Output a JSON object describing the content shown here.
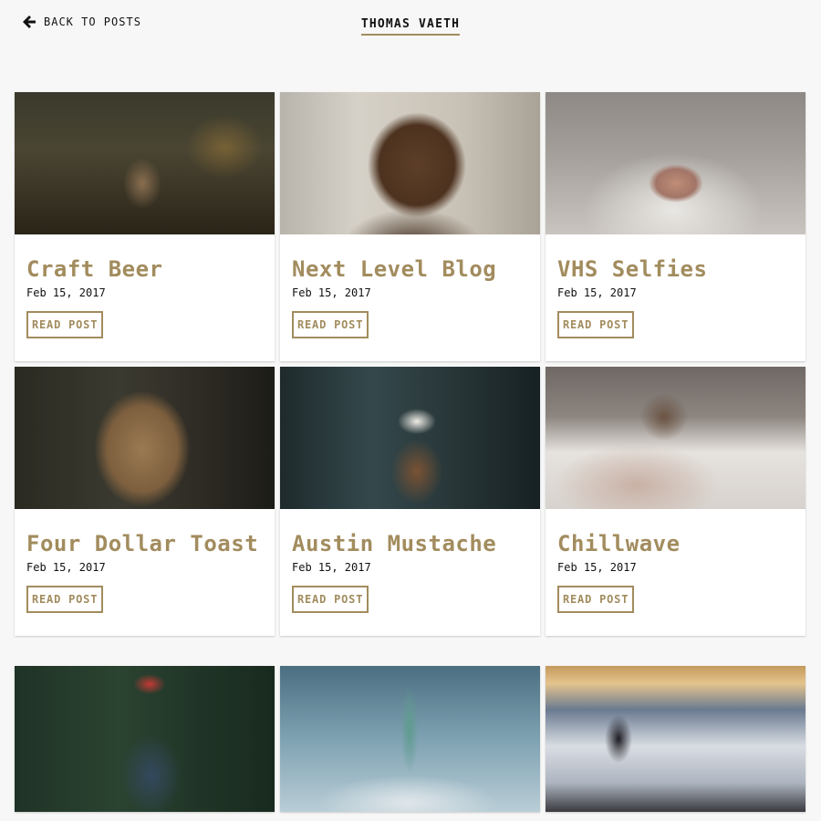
{
  "header": {
    "back_label": "BACK TO POSTS",
    "site_title": "THOMAS VAETH"
  },
  "colors": {
    "accent": "#a28c5e",
    "background": "#f7f7f7",
    "card": "#ffffff"
  },
  "posts": [
    {
      "title": "Craft Beer",
      "date": "Feb 15, 2017",
      "button": "READ POST",
      "image": "deer-photo"
    },
    {
      "title": "Next Level Blog",
      "date": "Feb 15, 2017",
      "button": "READ POST",
      "image": "bear-photo"
    },
    {
      "title": "VHS Selfies",
      "date": "Feb 15, 2017",
      "button": "READ POST",
      "image": "cat-nose-photo"
    },
    {
      "title": "Four Dollar Toast",
      "date": "Feb 15, 2017",
      "button": "READ POST",
      "image": "lioness-photo"
    },
    {
      "title": "Austin Mustache",
      "date": "Feb 15, 2017",
      "button": "READ POST",
      "image": "coffee-pour-over-photo"
    },
    {
      "title": "Chillwave",
      "date": "Feb 15, 2017",
      "button": "READ POST",
      "image": "pug-blanket-photo"
    },
    {
      "image": "photographer-photo"
    },
    {
      "image": "statue-of-liberty-photo"
    },
    {
      "image": "clouds-mountain-photo"
    }
  ]
}
